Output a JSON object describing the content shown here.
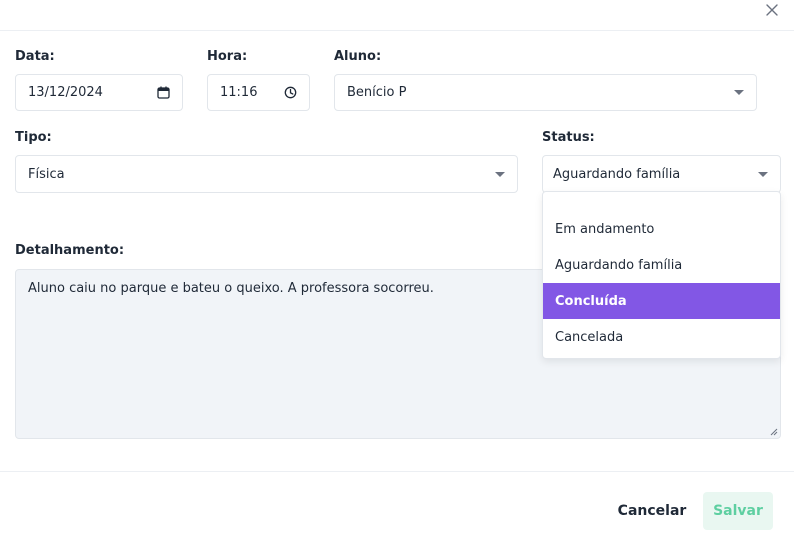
{
  "form": {
    "date_label": "Data:",
    "date_value": "13/12/2024",
    "time_label": "Hora:",
    "time_value": "11:16",
    "student_label": "Aluno:",
    "student_value": "Benício P",
    "type_label": "Tipo:",
    "type_value": "Física",
    "status_label": "Status:",
    "status_value": "Aguardando família",
    "details_label": "Detalhamento:",
    "details_value": "Aluno caiu no parque e bateu o queixo. A professora socorreu."
  },
  "status_options": [
    {
      "label": ""
    },
    {
      "label": "Em andamento"
    },
    {
      "label": "Aguardando família"
    },
    {
      "label": "Concluída"
    },
    {
      "label": "Cancelada"
    }
  ],
  "footer": {
    "cancel_label": "Cancelar",
    "save_label": "Salvar"
  },
  "colors": {
    "accent": "#8257e5",
    "save_text": "#5ecfa1",
    "save_bg": "#e9f7f1"
  },
  "icons": {
    "close": "close-icon",
    "calendar": "calendar-icon",
    "clock": "clock-icon",
    "select_caret": "chevron-down-icon"
  }
}
